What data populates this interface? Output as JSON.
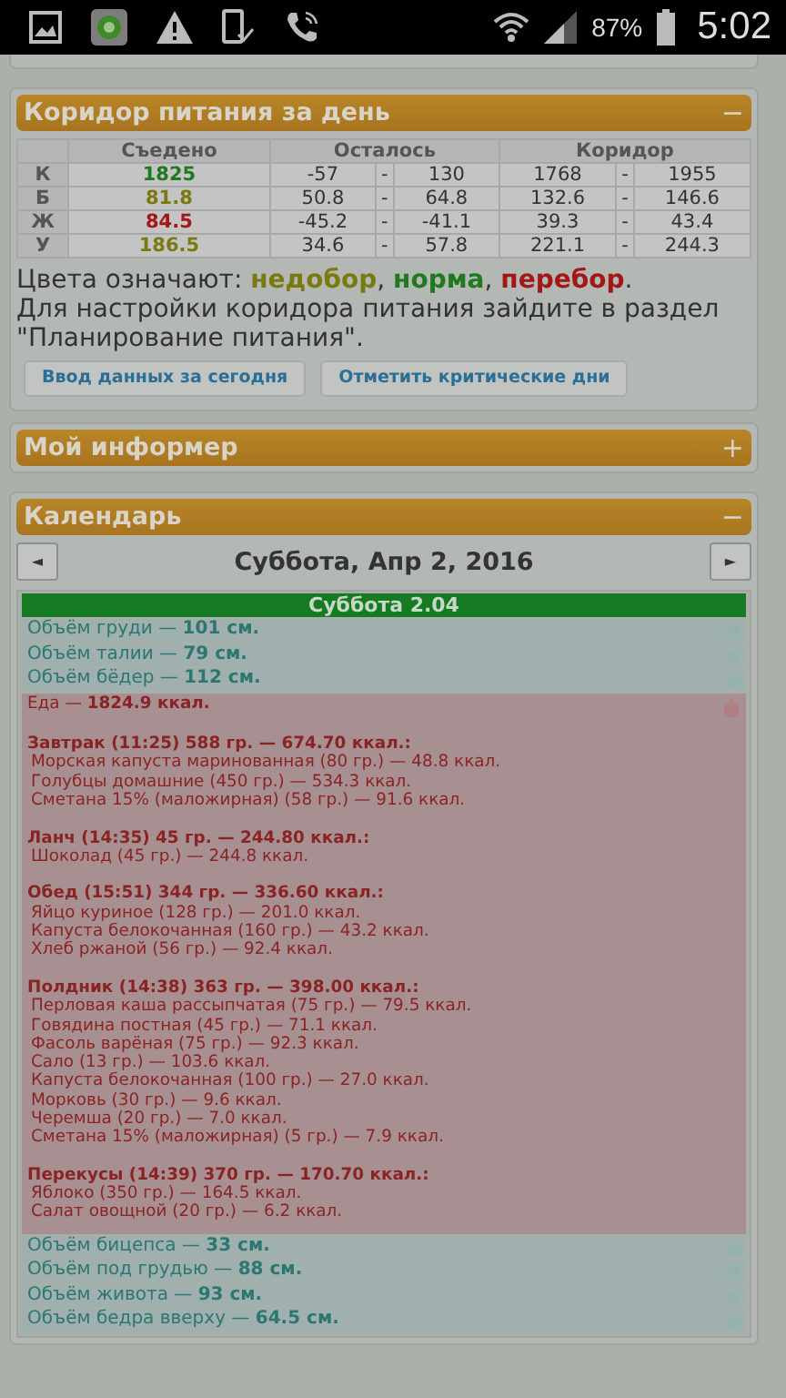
{
  "status_bar": {
    "battery": "87%",
    "time": "5:02"
  },
  "corridor_panel": {
    "title": "Коридор питания за день",
    "toggle": "−",
    "table": {
      "columns": [
        "",
        "Съедено",
        "Осталось",
        "Коридор"
      ],
      "rows": [
        {
          "label": "К",
          "eaten": "1825",
          "color": "#1f7a1f",
          "remaining": [
            "-57",
            "-",
            "130"
          ],
          "corridor": [
            "1768",
            "-",
            "1955"
          ]
        },
        {
          "label": "Б",
          "eaten": "81.8",
          "color": "#7a7a10",
          "remaining": [
            "50.8",
            "-",
            "64.8"
          ],
          "corridor": [
            "132.6",
            "-",
            "146.6"
          ]
        },
        {
          "label": "Ж",
          "eaten": "84.5",
          "color": "#a01818",
          "remaining": [
            "-45.2",
            "-",
            "-41.1"
          ],
          "corridor": [
            "39.3",
            "-",
            "43.4"
          ]
        },
        {
          "label": "У",
          "eaten": "186.5",
          "color": "#7a7a10",
          "remaining": [
            "34.6",
            "-",
            "57.8"
          ],
          "corridor": [
            "221.1",
            "-",
            "244.3"
          ]
        }
      ]
    },
    "legend": [
      {
        "text": "Цвета означают: "
      },
      {
        "text": "недобор",
        "color": "#7a7a10"
      },
      {
        "text": ", "
      },
      {
        "text": "норма",
        "color": "#1f7a1f"
      },
      {
        "text": ", "
      },
      {
        "text": "перебор",
        "color": "#a01818"
      },
      {
        "text": "."
      }
    ],
    "note": "Для настройки коридора питания зайдите в раздел \"Планирование питания\".",
    "buttons": [
      "Ввод данных за сегодня",
      "Отметить критические дни"
    ]
  },
  "informer_panel": {
    "title": "Мой информер",
    "toggle": "+"
  },
  "calendar_panel": {
    "title": "Календарь",
    "toggle": "−",
    "prev": "◄",
    "next": "►",
    "date": "Суббота, Апр 2, 2016",
    "day_header": "Суббота 2.04",
    "entries": [
      {
        "kind": "measure",
        "text": "Объём груди — **101 см.**"
      },
      {
        "kind": "measure",
        "text": "Объём талии — **79 см.**"
      },
      {
        "kind": "measure",
        "text": "Объём бёдер — **112 см.**"
      },
      {
        "kind": "food",
        "text": "Еда — **1824.9 ккал.**",
        "meals": [
          {
            "heading": "Завтрак (11:25) 588 гр. — 674.70 ккал.:",
            "items": [
              "Морская капуста маринованная (80 гр.) — 48.8 ккал.",
              "Голубцы домашние (450 гр.) — 534.3 ккал.",
              "Сметана 15% (маложирная) (58 гр.) — 91.6 ккал."
            ]
          },
          {
            "heading": "Ланч (14:35) 45 гр. — 244.80 ккал.:",
            "items": [
              "Шоколад (45 гр.) — 244.8 ккал."
            ]
          },
          {
            "heading": "Обед (15:51) 344 гр. — 336.60 ккал.:",
            "items": [
              "Яйцо куриное (128 гр.) — 201.0 ккал.",
              "Капуста белокочанная (160 гр.) — 43.2 ккал.",
              "Хлеб ржаной (56 гр.) — 92.4 ккал."
            ]
          },
          {
            "heading": "Полдник (14:38) 363 гр. — 398.00 ккал.:",
            "items": [
              "Перловая каша рассыпчатая (75 гр.) — 79.5 ккал.",
              "Говядина постная (45 гр.) — 71.1 ккал.",
              "Фасоль варёная (75 гр.) — 92.3 ккал.",
              "Сало (13 гр.) — 103.6 ккал.",
              "Капуста белокочанная (100 гр.) — 27.0 ккал.",
              "Морковь (30 гр.) — 9.6 ккал.",
              "Черемша (20 гр.) — 7.0 ккал.",
              "Сметана 15% (маложирная) (5 гр.) — 7.9 ккал."
            ]
          },
          {
            "heading": "Перекусы (14:39) 370 гр. — 170.70 ккал.:",
            "items": [
              "Яблоко (350 гр.) — 164.5 ккал.",
              "Салат овощной (20 гр.) — 6.2 ккал."
            ]
          }
        ]
      },
      {
        "kind": "measure",
        "text": "Объём бицепса — **33 см.**"
      },
      {
        "kind": "measure",
        "text": "Объём под грудью — **88 см.**"
      },
      {
        "kind": "measure",
        "text": "Объём живота — **93 см.**"
      },
      {
        "kind": "measure",
        "text": "Объём бедра вверху — **64.5 см.**"
      }
    ]
  }
}
